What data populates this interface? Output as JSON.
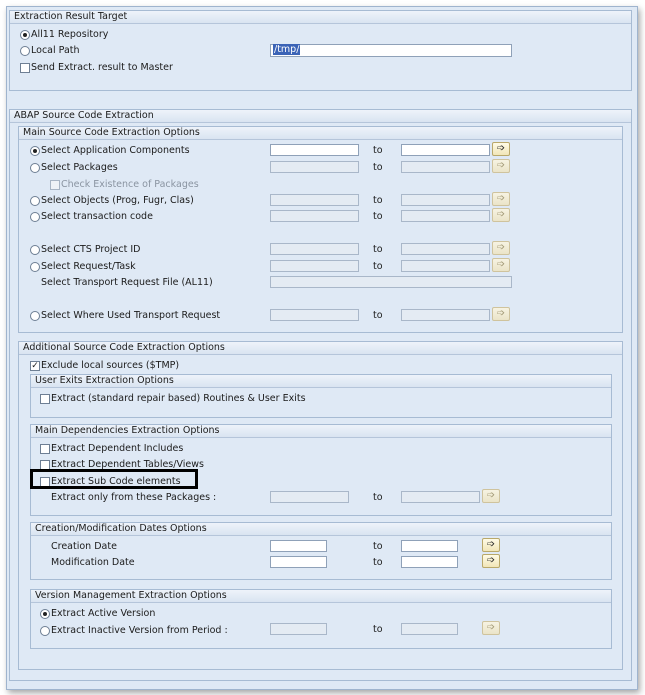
{
  "target": {
    "title": "Extraction Result Target",
    "all11": "All11 Repository",
    "local_path": "Local Path",
    "local_path_value": "/tmp/",
    "send_master": "Send Extract. result to Master"
  },
  "abap": {
    "title": "ABAP Source Code Extraction",
    "main": {
      "title": "Main Source Code Extraction Options",
      "app_components": "Select Application Components",
      "packages": "Select Packages",
      "check_packages": "Check Existence of Packages",
      "objects": "Select Objects (Prog, Fugr, Clas)",
      "transaction": "Select transaction code",
      "cts": "Select CTS Project ID",
      "request": "Select Request/Task",
      "transport_file": "Select Transport Request File (AL11)",
      "where_used": "Select Where Used Transport Request",
      "to": "to"
    },
    "additional": {
      "title": "Additional Source Code Extraction Options",
      "exclude_local": "Exclude local sources ($TMP)",
      "user_exits_title": "User Exits Extraction Options",
      "user_exits": "Extract (standard repair based) Routines & User Exits",
      "deps_title": "Main Dependencies Extraction Options",
      "dep_includes": "Extract Dependent Includes",
      "dep_tables": "Extract Dependent Tables/Views",
      "sub_code": "Extract Sub Code elements",
      "only_packages": "Extract only from these Packages :",
      "dates_title": "Creation/Modification Dates Options",
      "creation": "Creation Date",
      "modification": "Modification Date",
      "version_title": "Version Management Extraction Options",
      "active": "Extract Active Version",
      "inactive": "Extract Inactive Version from Period :",
      "to": "to"
    }
  },
  "icons": {
    "multi_select": "arrow-right-icon"
  },
  "colors": {
    "button_active": "#f1e6b8",
    "panel_bg": "#dfe9f5",
    "selection": "#3b63b6"
  }
}
